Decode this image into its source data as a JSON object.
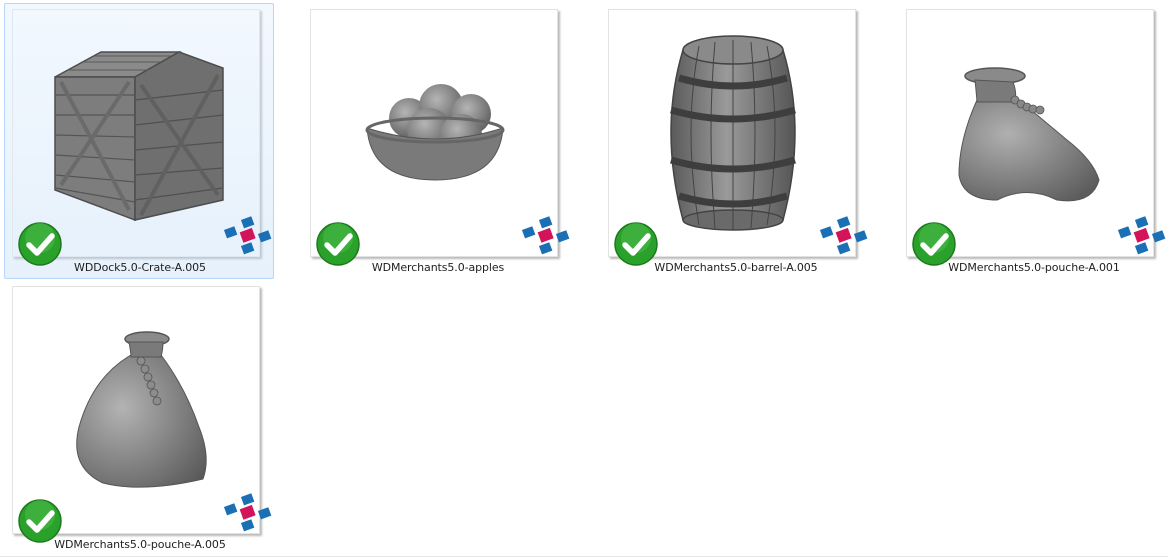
{
  "files": [
    {
      "name": "WDDock5.0-Crate-A.005",
      "model": "crate",
      "status": "synced",
      "selected": true
    },
    {
      "name": "WDMerchants5.0-apples",
      "model": "apples",
      "status": "synced",
      "selected": false
    },
    {
      "name": "WDMerchants5.0-barrel-A.005",
      "model": "barrel",
      "status": "synced",
      "selected": false
    },
    {
      "name": "WDMerchants5.0-pouche-A.001",
      "model": "pouch",
      "status": "synced",
      "selected": false
    },
    {
      "name": "WDMerchants5.0-pouche-A.005",
      "model": "pouch-tall",
      "status": "synced",
      "selected": false
    }
  ],
  "icons": {
    "overlay_status": "green-checkmark-icon",
    "overlay_app": "app-logo-icon"
  },
  "colors": {
    "check_green": "#2aa12a",
    "logo_blue": "#1a6fb5",
    "logo_magenta": "#d4145a",
    "model_gray": "#7a7a7a"
  }
}
